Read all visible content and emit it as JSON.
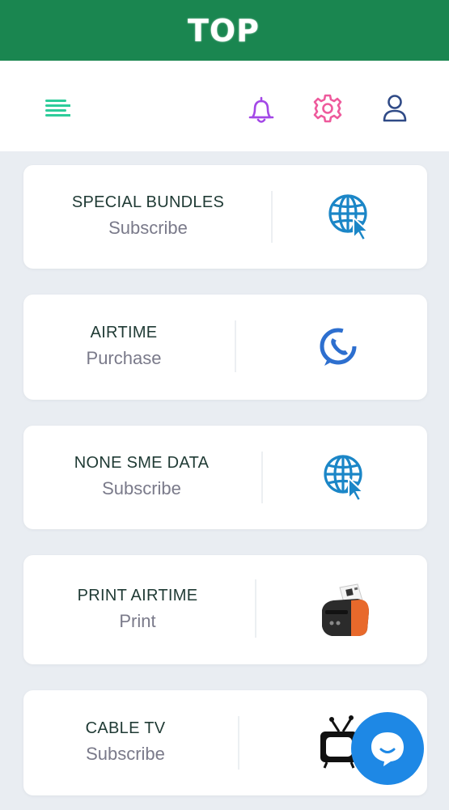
{
  "header": {
    "brand": "TOP",
    "color": "#1a8650"
  },
  "toolbar": {
    "icons": [
      "menu-icon",
      "bell-icon",
      "gear-icon",
      "user-icon"
    ],
    "colors": {
      "menu": "#2ecc9a",
      "bell": "#a347e6",
      "gear": "#ee5a9c",
      "user": "#2f4a86"
    }
  },
  "services": [
    {
      "title": "SPECIAL BUNDLES",
      "action": "Subscribe",
      "icon": "globe-cursor-icon"
    },
    {
      "title": "AIRTIME",
      "action": "Purchase",
      "icon": "phone-icon"
    },
    {
      "title": "NONE SME DATA",
      "action": "Subscribe",
      "icon": "globe-cursor-icon"
    },
    {
      "title": "PRINT AIRTIME",
      "action": "Print",
      "icon": "printer-icon"
    },
    {
      "title": "CABLE TV",
      "action": "Subscribe",
      "icon": "tv-icon"
    }
  ],
  "chat": {
    "icon": "chat-icon",
    "color": "#1e88e5"
  }
}
